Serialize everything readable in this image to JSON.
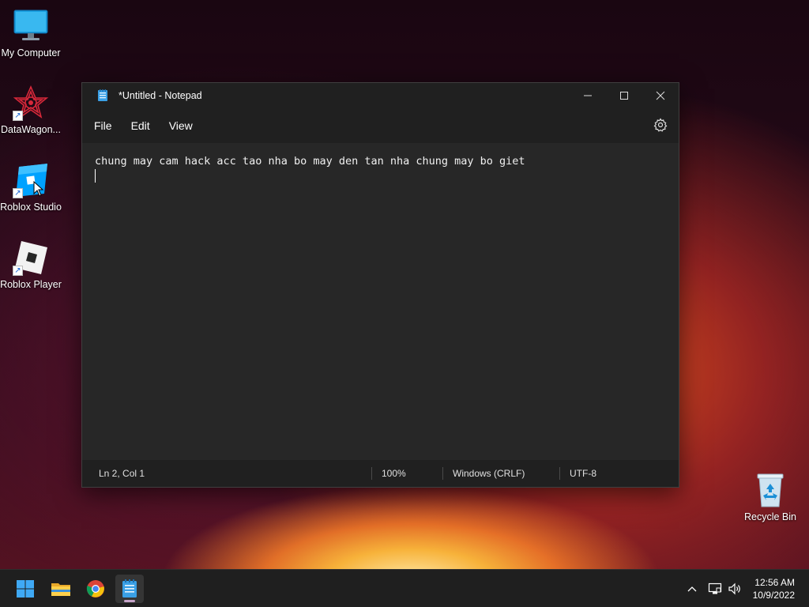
{
  "desktop": {
    "icons": [
      {
        "label": "My Computer",
        "icon": "monitor-icon"
      },
      {
        "label": "DataWagon...",
        "icon": "datawagon-logo-icon"
      },
      {
        "label": "Roblox Studio",
        "icon": "roblox-studio-icon"
      },
      {
        "label": "Roblox Player",
        "icon": "roblox-player-icon"
      },
      {
        "label": "Recycle Bin",
        "icon": "recycle-bin-icon"
      }
    ]
  },
  "notepad": {
    "title": "*Untitled - Notepad",
    "menu": [
      "File",
      "Edit",
      "View"
    ],
    "content": "chung may cam hack acc tao nha bo may den tan nha chung may bo giet",
    "status": {
      "position": "Ln 2, Col 1",
      "zoom": "100%",
      "line_ending": "Windows (CRLF)",
      "encoding": "UTF-8"
    }
  },
  "taskbar": {
    "apps": [
      "start-icon",
      "file-explorer-icon",
      "chrome-icon",
      "notepad-icon"
    ],
    "active_app": "notepad-icon",
    "clock": {
      "time": "12:56 AM",
      "date": "10/9/2022"
    }
  },
  "colors": {
    "window_bg": "#272727",
    "titlebar_bg": "#202020",
    "taskbar_bg": "#1f1f1f",
    "accent": "#0078d4"
  }
}
